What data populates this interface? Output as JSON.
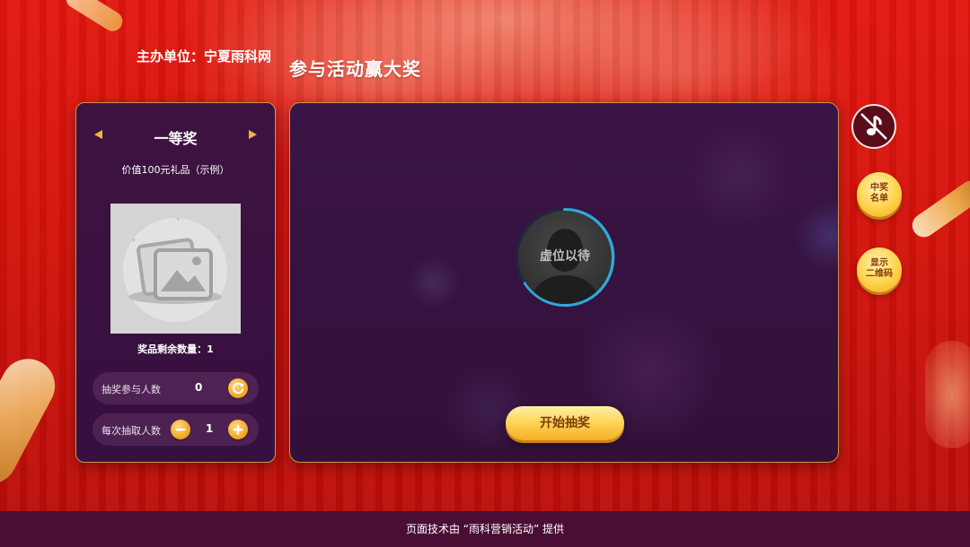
{
  "header": {
    "organizer": "主办单位：宁夏雨科网",
    "title": "参与活动赢大奖"
  },
  "prize": {
    "name": "一等奖",
    "description": "价值100元礼品（示例）",
    "remaining": "奖品剩余数量：1",
    "image_icon": "image-placeholder-icon"
  },
  "stats": {
    "participants_label": "抽奖参与人数",
    "participants_value": "0",
    "per_draw_label": "每次抽取人数",
    "per_draw_value": "1"
  },
  "stage": {
    "avatar_text": "虚位以待",
    "start_label": "开始抽奖"
  },
  "side": {
    "music_icon": "music-off-icon",
    "winners_line1": "中奖",
    "winners_line2": "名单",
    "qrcode_line1": "显示",
    "qrcode_line2": "二维码"
  },
  "footer": {
    "text": "页面技术由 “雨科营销活动” 提供"
  },
  "colors": {
    "background_red": "#d3130b",
    "panel_purple": "#3a1446",
    "gold": "#f2a21e",
    "border_gold": "#c8964a",
    "footer": "#4a0d33"
  }
}
